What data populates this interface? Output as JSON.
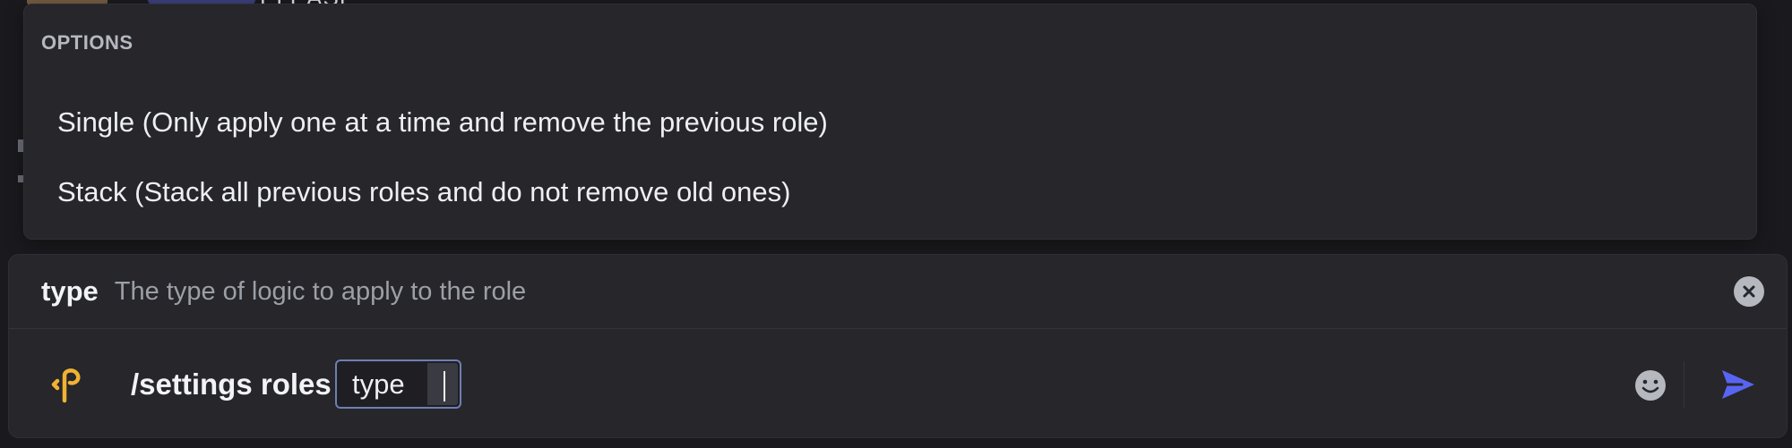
{
  "background_peek": {
    "text": "PLEASE"
  },
  "options_popup": {
    "header": "OPTIONS",
    "items": [
      {
        "label": "Single (Only apply one at a time and remove the previous role)"
      },
      {
        "label": "Stack (Stack all previous roles and do not remove old ones)"
      }
    ]
  },
  "composer": {
    "param_name": "type",
    "param_description": "The type of logic to apply to the role",
    "command": "/settings roles",
    "chip_label": "type",
    "icons": {
      "app": "command-app-icon",
      "close": "close-icon",
      "emoji": "emoji-icon",
      "send": "send-icon"
    }
  },
  "colors": {
    "accent": "#5865f2",
    "app_icon": "#f0b232",
    "chip_border": "#6e7fb4"
  }
}
